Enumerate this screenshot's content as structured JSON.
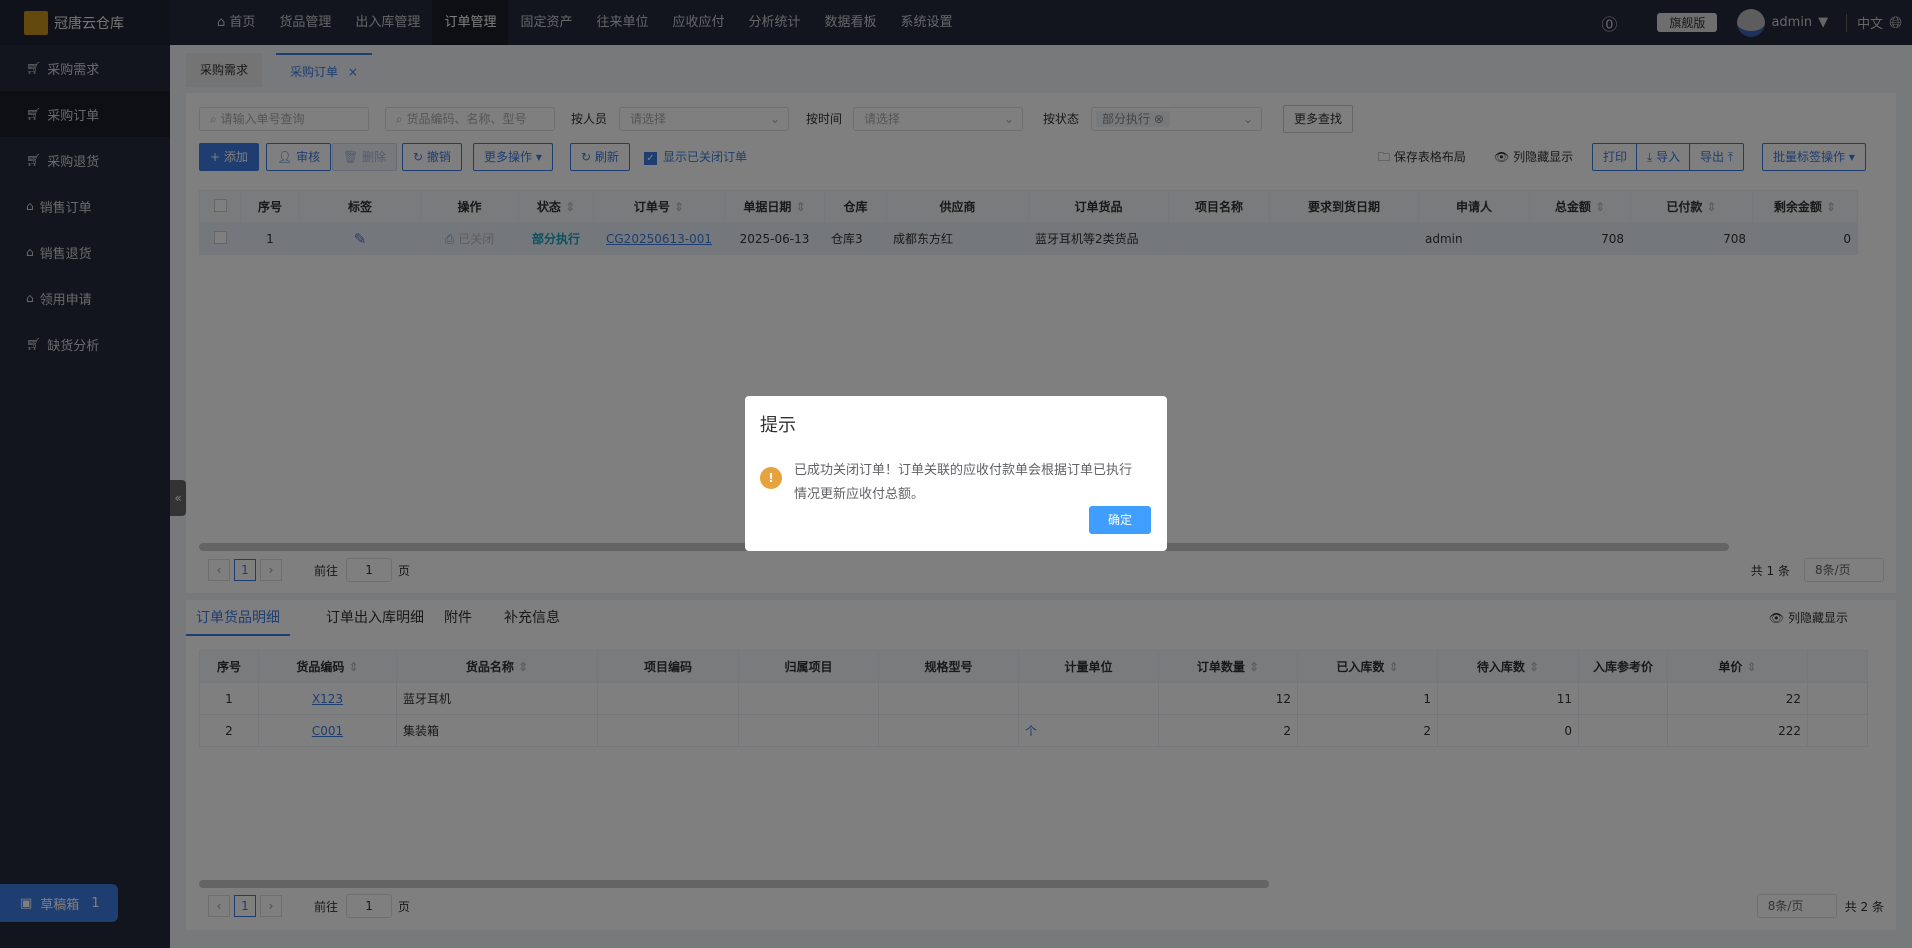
{
  "app": {
    "name": "冠唐云仓库"
  },
  "nav": [
    "首页",
    "货品管理",
    "出入库管理",
    "订单管理",
    "固定资产",
    "往来单位",
    "应收应付",
    "分析统计",
    "数据看板",
    "系统设置"
  ],
  "nav_active": 3,
  "header": {
    "edition": "旗舰版",
    "user": "admin",
    "lang": "中文"
  },
  "sidebar": [
    "采购需求",
    "采购订单",
    "采购退货",
    "销售订单",
    "销售退货",
    "领用申请",
    "缺货分析"
  ],
  "sidebar_active": 1,
  "draft": {
    "label": "草稿箱",
    "count": "1"
  },
  "tabs": [
    {
      "label": "采购需求"
    },
    {
      "label": "采购订单",
      "close": "×"
    }
  ],
  "filters": {
    "order_ph": "请输入单号查询",
    "goods_ph": "货品编码、名称、型号",
    "by_person": "按人员",
    "by_time": "按时间",
    "by_status": "按状态",
    "select_ph": "请选择",
    "status_tag": "部分执行",
    "more": "更多查找"
  },
  "toolbar": {
    "add": "+ 添加",
    "audit": "审核",
    "delete": "删除",
    "revoke": "撤销",
    "more_ops": "更多操作 ▾",
    "refresh": "刷新",
    "show_closed": "显示已关闭订单",
    "save_layout": "保存表格布局",
    "col_toggle": "列隐藏显示",
    "print": "打印",
    "import": "导入",
    "export": "导出",
    "batch_tag": "批量标签操作 ▾"
  },
  "orders": {
    "columns": [
      "",
      "序号",
      "标签",
      "操作",
      "状态",
      "订单号",
      "单据日期",
      "仓库",
      "供应商",
      "订单货品",
      "项目名称",
      "要求到货日期",
      "申请人",
      "总金额",
      "已付款",
      "剩余金额"
    ],
    "rows": [
      [
        "",
        "1",
        "✎",
        "已关闭",
        "部分执行",
        "CG20250613-001",
        "2025-06-13",
        "仓库3",
        "成都东方红",
        "蓝牙耳机等2类货品",
        "",
        "",
        "admin",
        "708",
        "708",
        "0"
      ]
    ],
    "pager": {
      "page": "1",
      "goto": "前往",
      "goto_val": "1",
      "page_unit": "页",
      "total": "共 1 条",
      "size": "8条/页"
    }
  },
  "detail_tabs": [
    "订单货品明细",
    "订单出入库明细",
    "附件",
    "补充信息"
  ],
  "detail_col_toggle": "列隐藏显示",
  "items": {
    "columns": [
      "序号",
      "货品编码",
      "货品名称",
      "项目编码",
      "归属项目",
      "规格型号",
      "计量单位",
      "订单数量",
      "已入库数",
      "待入库数",
      "入库参考价",
      "单价",
      ""
    ],
    "rows": [
      [
        "1",
        "X123",
        "蓝牙耳机",
        "",
        "",
        "",
        "",
        "12",
        "1",
        "11",
        "",
        "22",
        ""
      ],
      [
        "2",
        "C001",
        "集装箱",
        "",
        "",
        "",
        "个",
        "2",
        "2",
        "0",
        "",
        "222",
        ""
      ]
    ],
    "pager": {
      "page": "1",
      "goto": "前往",
      "goto_val": "1",
      "page_unit": "页",
      "total": "共 2 条",
      "size": "8条/页"
    }
  },
  "modal": {
    "title": "提示",
    "message": "已成功关闭订单！订单关联的应收付款单会根据订单已执行情况更新应收付总额。",
    "ok": "确定"
  }
}
